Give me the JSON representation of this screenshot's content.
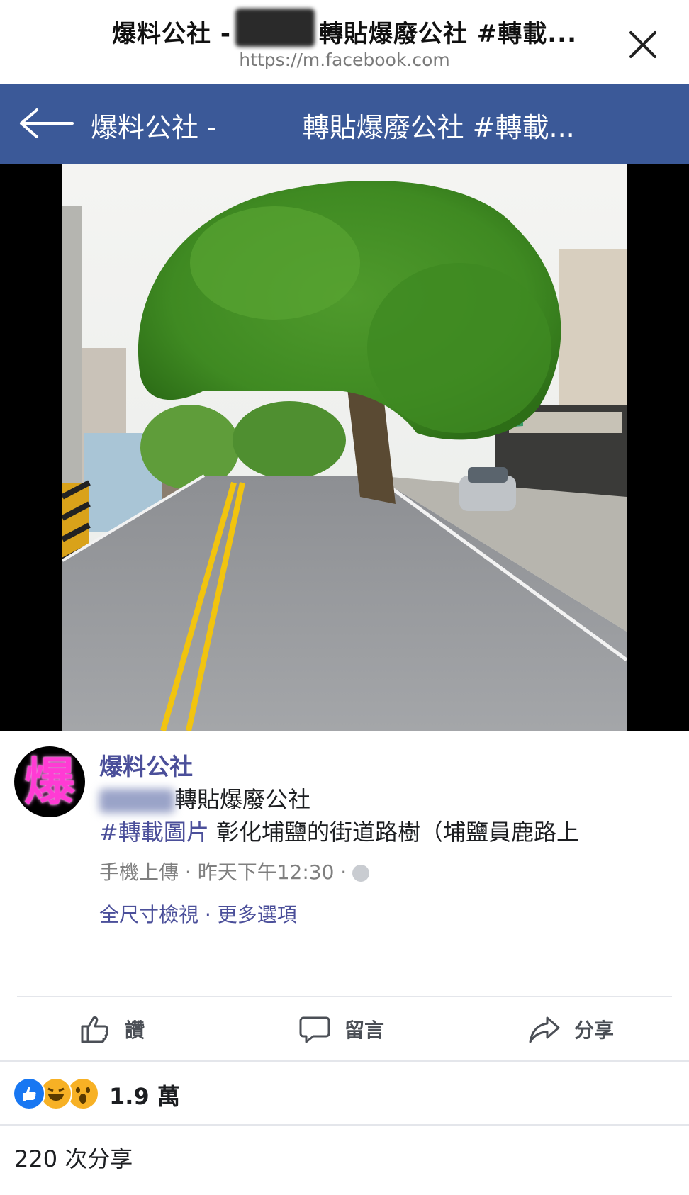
{
  "browser": {
    "title_left": "爆料公社 -",
    "title_right": "轉貼爆廢公社 #轉載...",
    "url": "https://m.facebook.com"
  },
  "navbar": {
    "title": "爆料公社 -          轉貼爆廢公社 #轉載..."
  },
  "post": {
    "avatar_text": "爆",
    "page_name": "爆料公社",
    "subtitle": "轉貼爆廢公社",
    "hashtag": "#轉載圖片",
    "body": " 彰化埔鹽的街道路樹（埔鹽員鹿路上",
    "meta_source": "手機上傳 · 昨天下午12:30 ·",
    "full_size": "全尺寸檢視",
    "more_options": "· 更多選項"
  },
  "actions": {
    "like": "讚",
    "comment": "留言",
    "share": "分享"
  },
  "reactions": {
    "count": "1.9 萬"
  },
  "shares": {
    "text": "220 次分享"
  },
  "colors": {
    "fb_blue": "#3b5998",
    "link_purple": "#4b4f9a"
  }
}
